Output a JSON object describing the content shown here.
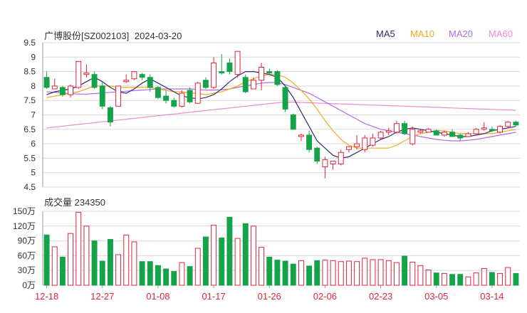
{
  "header": {
    "stock": "广博股份[SZ002103]",
    "date": "2024-03-20"
  },
  "legend": [
    {
      "label": "MA5",
      "color": "#2c2c6e"
    },
    {
      "label": "MA10",
      "color": "#f5a623"
    },
    {
      "label": "MA20",
      "color": "#b36be0"
    },
    {
      "label": "MA60",
      "color": "#f08ad0"
    }
  ],
  "volume_title": "成交量 234350",
  "colors": {
    "up": "#e0243e",
    "down": "#15a34a",
    "grid": "#d9d9d9"
  },
  "chart_data": [
    {
      "type": "candlestick",
      "ylim": [
        4.5,
        9.5
      ],
      "yticks": [
        "9.5",
        "9",
        "8.5",
        "8",
        "7.5",
        "7",
        "6.5",
        "6",
        "5.5",
        "5",
        "4.5"
      ],
      "xticklabels": [
        "12-18",
        "12-27",
        "01-08",
        "01-17",
        "01-26",
        "02-06",
        "02-23",
        "03-05",
        "03-14"
      ],
      "ohlc": [
        [
          8.3,
          8.5,
          7.9,
          7.95
        ],
        [
          7.9,
          8.25,
          7.9,
          8.0
        ],
        [
          7.95,
          8.0,
          7.62,
          7.7
        ],
        [
          7.7,
          8.05,
          7.6,
          8.0
        ],
        [
          7.95,
          8.85,
          7.9,
          8.85
        ],
        [
          8.4,
          8.75,
          8.3,
          8.45
        ],
        [
          8.4,
          8.5,
          7.9,
          7.95
        ],
        [
          8.0,
          8.15,
          7.2,
          7.3
        ],
        [
          7.25,
          7.3,
          6.6,
          6.75
        ],
        [
          7.3,
          8.0,
          7.3,
          8.0
        ],
        [
          8.15,
          8.4,
          8.1,
          8.2
        ],
        [
          8.25,
          8.5,
          8.2,
          8.5
        ],
        [
          8.4,
          8.45,
          8.2,
          8.3
        ],
        [
          8.3,
          8.4,
          7.8,
          7.95
        ],
        [
          7.95,
          8.0,
          7.55,
          7.6
        ],
        [
          7.65,
          7.85,
          7.4,
          7.5
        ],
        [
          7.5,
          7.6,
          7.25,
          7.3
        ],
        [
          7.3,
          7.85,
          7.25,
          7.75
        ],
        [
          7.85,
          7.95,
          7.4,
          7.45
        ],
        [
          7.4,
          8.15,
          7.4,
          8.1
        ],
        [
          8.2,
          8.3,
          7.9,
          7.95
        ],
        [
          7.95,
          9.0,
          7.9,
          8.8
        ],
        [
          8.5,
          9.1,
          8.4,
          8.45
        ],
        [
          8.8,
          8.95,
          8.4,
          8.5
        ],
        [
          8.4,
          9.2,
          8.3,
          9.2
        ],
        [
          8.3,
          8.4,
          7.75,
          7.8
        ],
        [
          7.9,
          8.3,
          7.9,
          8.2
        ],
        [
          8.2,
          8.8,
          7.85,
          8.65
        ],
        [
          8.5,
          8.6,
          8.4,
          8.45
        ],
        [
          8.5,
          8.55,
          8.0,
          8.05
        ],
        [
          7.95,
          8.0,
          7.1,
          7.2
        ],
        [
          7.0,
          7.05,
          6.5,
          6.5
        ],
        [
          6.25,
          6.35,
          6.1,
          6.3
        ],
        [
          6.3,
          6.45,
          5.7,
          5.8
        ],
        [
          5.85,
          5.9,
          5.3,
          5.4
        ],
        [
          5.2,
          5.55,
          4.8,
          5.45
        ],
        [
          5.3,
          5.4,
          5.1,
          5.4
        ],
        [
          5.3,
          5.8,
          5.25,
          5.7
        ],
        [
          5.8,
          5.9,
          5.7,
          5.9
        ],
        [
          5.9,
          6.3,
          5.8,
          6.0
        ],
        [
          5.8,
          6.3,
          5.7,
          6.2
        ],
        [
          5.95,
          6.35,
          5.9,
          6.2
        ],
        [
          6.2,
          6.45,
          6.15,
          6.4
        ],
        [
          6.4,
          6.55,
          6.3,
          6.45
        ],
        [
          6.4,
          6.8,
          6.35,
          6.7
        ],
        [
          6.7,
          6.8,
          6.3,
          6.35
        ],
        [
          6.0,
          6.6,
          5.95,
          6.5
        ],
        [
          6.4,
          6.5,
          6.35,
          6.45
        ],
        [
          6.4,
          6.55,
          6.4,
          6.5
        ],
        [
          6.45,
          6.5,
          6.3,
          6.3
        ],
        [
          6.3,
          6.45,
          6.25,
          6.4
        ],
        [
          6.4,
          6.5,
          6.25,
          6.25
        ],
        [
          6.3,
          6.35,
          6.1,
          6.2
        ],
        [
          6.25,
          6.4,
          6.25,
          6.35
        ],
        [
          6.35,
          6.55,
          6.3,
          6.5
        ],
        [
          6.5,
          6.75,
          6.45,
          6.55
        ],
        [
          6.5,
          6.6,
          6.4,
          6.45
        ],
        [
          6.4,
          6.65,
          6.35,
          6.6
        ],
        [
          6.6,
          6.8,
          6.55,
          6.75
        ],
        [
          6.75,
          6.8,
          6.6,
          6.65
        ]
      ],
      "ma5": [
        7.7,
        7.8,
        7.85,
        7.9,
        8.0,
        8.15,
        8.3,
        8.15,
        7.95,
        7.8,
        7.75,
        7.9,
        8.1,
        8.25,
        8.1,
        7.95,
        7.8,
        7.65,
        7.6,
        7.55,
        7.6,
        7.7,
        7.9,
        8.15,
        8.35,
        8.5,
        8.5,
        8.45,
        8.4,
        8.3,
        8.0,
        7.6,
        7.1,
        6.6,
        6.1,
        5.85,
        5.6,
        5.5,
        5.55,
        5.7,
        5.85,
        6.0,
        6.15,
        6.25,
        6.4,
        6.5,
        6.55,
        6.5,
        6.45,
        6.4,
        6.35,
        6.3,
        6.25,
        6.25,
        6.3,
        6.35,
        6.45,
        6.5,
        6.55,
        6.6
      ],
      "ma10": [
        7.6,
        7.65,
        7.7,
        7.75,
        7.8,
        7.9,
        8.0,
        8.0,
        8.0,
        7.95,
        7.95,
        7.95,
        7.95,
        7.95,
        7.9,
        7.85,
        7.8,
        7.8,
        7.75,
        7.75,
        7.7,
        7.75,
        7.8,
        7.9,
        8.0,
        8.15,
        8.25,
        8.35,
        8.4,
        8.4,
        8.3,
        8.1,
        7.85,
        7.55,
        7.2,
        6.8,
        6.45,
        6.15,
        5.95,
        5.85,
        5.85,
        5.85,
        5.85,
        5.85,
        5.95,
        6.1,
        6.25,
        6.35,
        6.4,
        6.45,
        6.45,
        6.4,
        6.35,
        6.35,
        6.35,
        6.35,
        6.35,
        6.4,
        6.45,
        6.5
      ],
      "ma20": [
        7.8,
        7.78,
        7.76,
        7.74,
        7.72,
        7.72,
        7.74,
        7.76,
        7.78,
        7.8,
        7.82,
        7.84,
        7.86,
        7.88,
        7.9,
        7.9,
        7.9,
        7.9,
        7.9,
        7.88,
        7.86,
        7.86,
        7.87,
        7.9,
        7.95,
        8.0,
        8.05,
        8.1,
        8.12,
        8.12,
        8.05,
        7.95,
        7.85,
        7.75,
        7.6,
        7.45,
        7.3,
        7.15,
        7.0,
        6.85,
        6.7,
        6.6,
        6.5,
        6.45,
        6.4,
        6.35,
        6.3,
        6.25,
        6.2,
        6.15,
        6.12,
        6.1,
        6.1,
        6.12,
        6.15,
        6.2,
        6.25,
        6.3,
        6.35,
        6.4
      ],
      "ma60": [
        6.55,
        6.58,
        6.61,
        6.64,
        6.67,
        6.7,
        6.73,
        6.76,
        6.79,
        6.82,
        6.85,
        6.88,
        6.91,
        6.94,
        6.97,
        7.0,
        7.03,
        7.06,
        7.09,
        7.12,
        7.15,
        7.18,
        7.21,
        7.24,
        7.27,
        7.3,
        7.33,
        7.36,
        7.39,
        7.42,
        7.44,
        7.44,
        7.43,
        7.42,
        7.41,
        7.4,
        7.39,
        7.38,
        7.37,
        7.36,
        7.35,
        7.34,
        7.33,
        7.32,
        7.31,
        7.3,
        7.29,
        7.28,
        7.27,
        7.26,
        7.25,
        7.24,
        7.23,
        7.22,
        7.21,
        7.2,
        7.19,
        7.18,
        7.17,
        7.16
      ]
    },
    {
      "type": "bar",
      "title": "成交量 234350",
      "ylim": [
        0,
        150
      ],
      "yticks": [
        "150万",
        "120万",
        "90万",
        "60万",
        "30万",
        "0万"
      ],
      "values": [
        102,
        78,
        57,
        105,
        148,
        120,
        90,
        49,
        93,
        62,
        102,
        88,
        48,
        48,
        40,
        33,
        28,
        46,
        38,
        75,
        98,
        122,
        96,
        138,
        95,
        125,
        120,
        77,
        57,
        51,
        49,
        43,
        50,
        39,
        50,
        51,
        50,
        48,
        49,
        48,
        55,
        52,
        52,
        50,
        46,
        59,
        47,
        40,
        31,
        25,
        24,
        22,
        22,
        17,
        25,
        34,
        26,
        24,
        36,
        24
      ]
    }
  ]
}
